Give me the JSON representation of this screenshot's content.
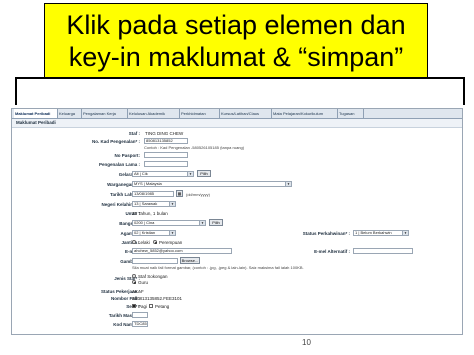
{
  "callout": {
    "line1": "Klik pada setiap elemen dan",
    "line2": "key-in maklumat & “simpan”"
  },
  "tabs": [
    {
      "label": "Maklumat Peribadi",
      "active": true
    },
    {
      "label": "Keluarga"
    },
    {
      "label": "Pengalaman Kerja"
    },
    {
      "label": "Kelulusan Akademik"
    },
    {
      "label": "Perkhidmatan"
    },
    {
      "label": "Kursus/Latihan/Claus"
    },
    {
      "label": "Mata Pelajaran/Kokurikulum"
    },
    {
      "label": "Tugasan"
    }
  ],
  "section_title": "Maklumat Peribadi",
  "fields": {
    "staf": {
      "label": "Staf :",
      "value": "TING DING CHEW"
    },
    "kad_pengenalan": {
      "label": "No. Kad Pengenalan* :",
      "value": "850813135852",
      "note": "Contoh : Kad Pengenalan -580526105185 (tanpa ruang)"
    },
    "pasport": {
      "label": "No Pasport:"
    },
    "pengenalan_lama": {
      "label": "Pengenalan Lama :"
    },
    "gelaran": {
      "label": "Gelaran* :",
      "value": "Alt | Cik",
      "button": "Pilih"
    },
    "warganegara": {
      "label": "Warganegara* :",
      "value": "MYS | Malaysia"
    },
    "tarikh_lahir": {
      "label": "Tarikh Lahir* :",
      "value": "13/08/1985",
      "note": "(dd/mm/yyyy)"
    },
    "negeri_kelahiran": {
      "label": "Negeri Kelahiran :",
      "value": "13 | Sarawak"
    },
    "umur": {
      "label": "Umur :",
      "value": "25 Tahun, 1 bulan"
    },
    "bangsa": {
      "label": "Bangsa* :",
      "value": "0200 | Cina",
      "button": "Pilih"
    },
    "agama": {
      "label": "Agama* :",
      "value": "02 | Kristian"
    },
    "status_perkahwinan": {
      "label": "Status Perkahwinan* :",
      "value": "1 | Belum Berkahwin"
    },
    "jantina": {
      "label": "Jantina :",
      "options": [
        "Lelaki",
        "Perempuan"
      ],
      "selected": 1
    },
    "email": {
      "label": "E-mel :",
      "value": "ahchew_5852@yahoo.com"
    },
    "email_alt": {
      "label": "E-mel Alternatif :"
    },
    "gambar": {
      "label": "Gambar :",
      "button": "Browse...",
      "note": "Sila muat naik fail format gambar, (contoh : .jpg, .jpeg & lain-lain). Saiz maksima fail ialah 100KB."
    },
    "jenis_staf": {
      "label": "Jenis Staf* :",
      "options": [
        "Staf Sokongan",
        "Guru"
      ],
      "selected": 1
    },
    "status_pekerjaan": {
      "label": "Status Pekerjaan :",
      "value": "AKAF"
    },
    "nombor_fail": {
      "label": "Nombor Fail :",
      "value": "850813135852.FEE3101"
    },
    "sesi": {
      "label": "Sesi* :",
      "options": [
        "Pagi",
        "Petang"
      ],
      "checked": [
        true,
        false
      ]
    },
    "tarikh_masuk": {
      "label": "Tarikh Masuk :",
      "value": ""
    },
    "kod_nama": {
      "label": "Kod Nama* :",
      "value": "TDC85"
    }
  },
  "page_number": "10"
}
